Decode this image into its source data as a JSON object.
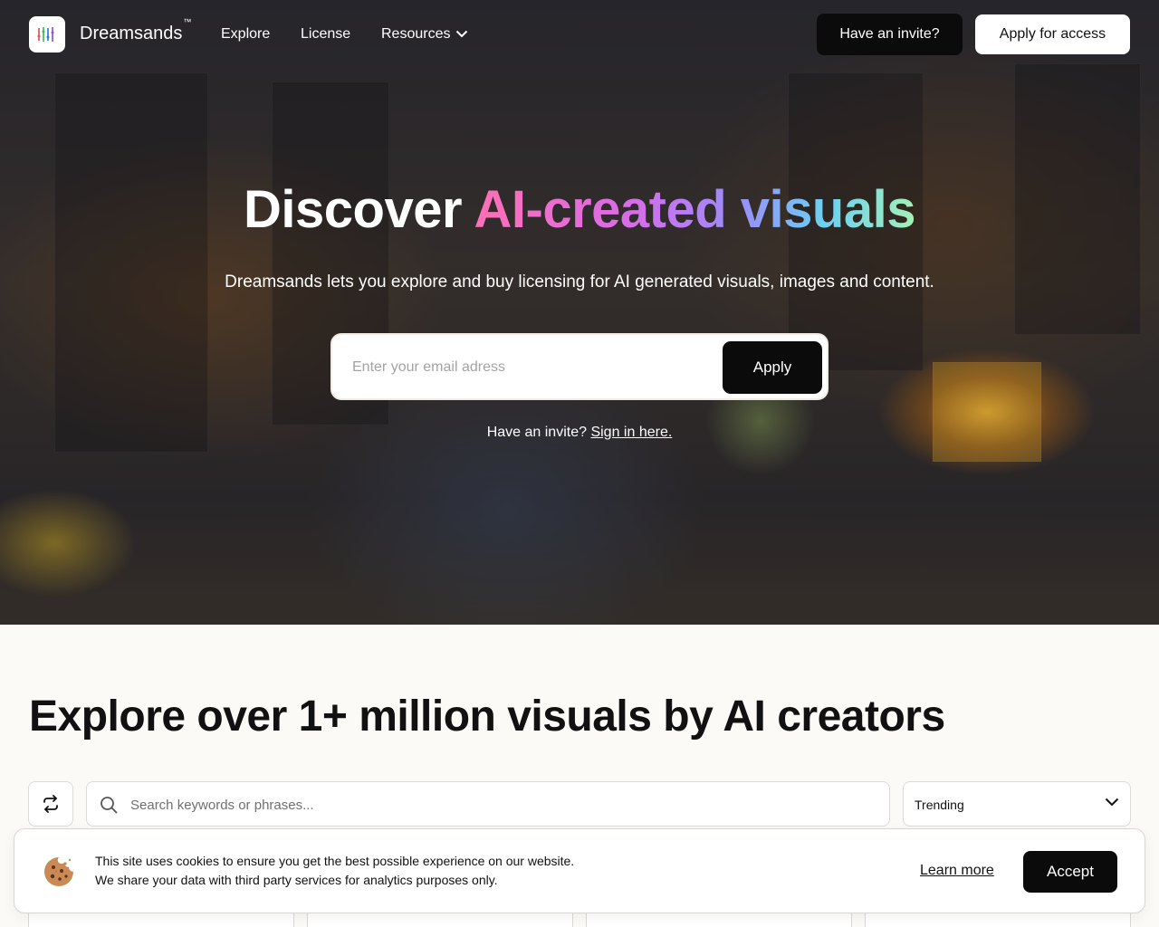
{
  "nav": {
    "brand": "Dreamsands",
    "brand_mark": "™",
    "links": [
      {
        "label": "Explore"
      },
      {
        "label": "License"
      },
      {
        "label": "Resources"
      }
    ],
    "invite_button": "Have an invite?",
    "apply_button": "Apply for access"
  },
  "hero": {
    "title_plain": "Discover ",
    "title_gradient": "AI-created visuals",
    "subtitle": "Dreamsands lets you explore and buy licensing for AI generated visuals, images and content.",
    "email_placeholder": "Enter your email adress",
    "apply_button": "Apply",
    "invite_text": "Have an invite?",
    "invite_link": "Sign in here."
  },
  "explore": {
    "title": "Explore over 1+ million visuals by AI creators",
    "search_placeholder": "Search keywords or phrases...",
    "sort_value": "Trending"
  },
  "cookie": {
    "line1": "This site uses cookies to ensure you get the best possible experience on our website.",
    "line2": "We share your data with third party services for analytics purposes only.",
    "learn_more": "Learn more",
    "accept": "Accept"
  },
  "colors": {
    "accent_dark": "#0b0b0b",
    "gradient": [
      "#ff6fb5",
      "#d86ce8",
      "#9a8dfb",
      "#6bd2f0",
      "#a5f0b8"
    ]
  },
  "icons": {
    "logo": "equalizer-bars-icon",
    "resources_chevron": "chevron-down-icon",
    "refresh": "refresh-icon",
    "search": "search-icon",
    "sort_chevron": "chevron-down-icon",
    "cookie": "cookie-icon"
  }
}
